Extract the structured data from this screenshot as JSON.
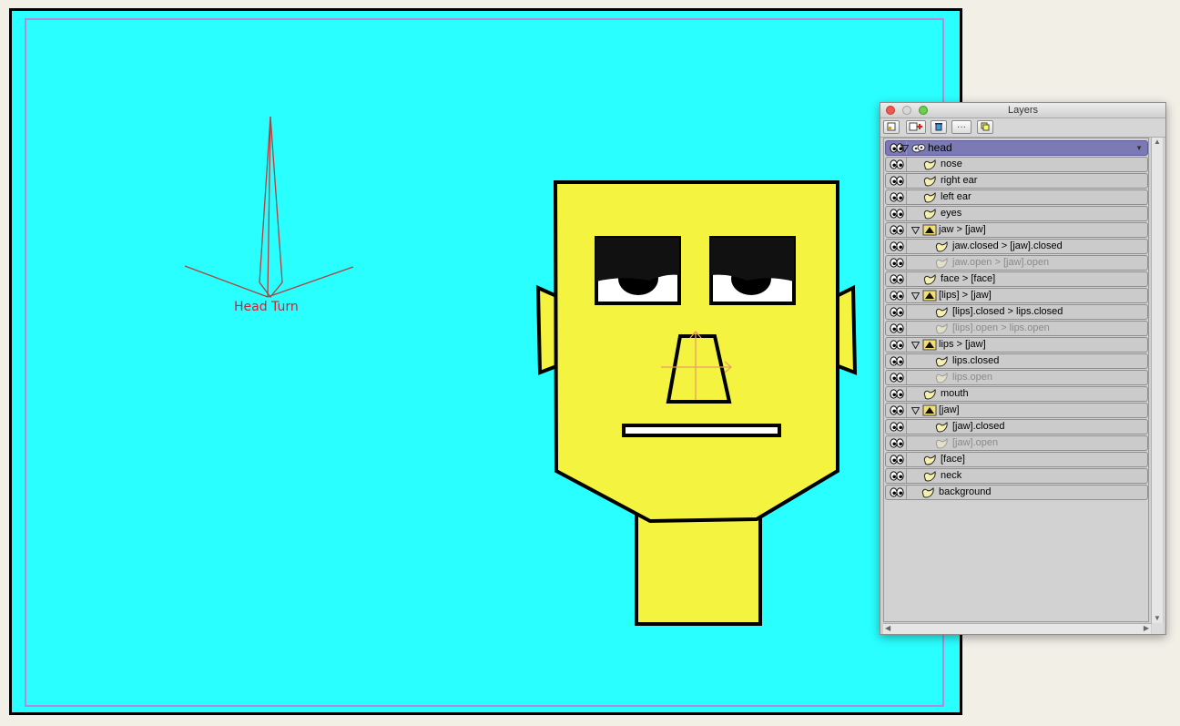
{
  "canvas": {
    "background_color": "#29ffff",
    "safe_frame_color": "#b48bd9",
    "bone_label": "Head Turn",
    "bone_color": "#a33",
    "face_color": "#f3f340"
  },
  "layers_panel": {
    "title": "Layers",
    "toolbar_icons": [
      "new-layer-icon",
      "new-group-icon",
      "delete-layer-icon",
      "more-options-icon",
      "duplicate-layer-icon"
    ],
    "more_label": "···",
    "layers": [
      {
        "label": "head",
        "kind": "group",
        "expanded": true,
        "selected": true,
        "visible": true,
        "depth": 0
      },
      {
        "label": "nose",
        "kind": "vector",
        "visible": true,
        "depth": 1
      },
      {
        "label": "right ear",
        "kind": "vector",
        "visible": true,
        "depth": 1
      },
      {
        "label": "left ear",
        "kind": "vector",
        "visible": true,
        "depth": 1
      },
      {
        "label": "eyes",
        "kind": "vector",
        "visible": true,
        "depth": 1
      },
      {
        "label": "jaw > [jaw]",
        "kind": "switch",
        "expanded": true,
        "visible": true,
        "depth": 1
      },
      {
        "label": "jaw.closed > [jaw].closed",
        "kind": "vector",
        "visible": true,
        "depth": 2
      },
      {
        "label": "jaw.open > [jaw].open",
        "kind": "vector",
        "visible": false,
        "depth": 2
      },
      {
        "label": "face > [face]",
        "kind": "vector",
        "visible": true,
        "depth": 1
      },
      {
        "label": "[lips] > [jaw]",
        "kind": "switch",
        "expanded": true,
        "visible": true,
        "depth": 1
      },
      {
        "label": "[lips].closed > lips.closed",
        "kind": "vector",
        "visible": true,
        "depth": 2
      },
      {
        "label": "[lips].open > lips.open",
        "kind": "vector",
        "visible": false,
        "depth": 2
      },
      {
        "label": "lips > [jaw]",
        "kind": "switch",
        "expanded": true,
        "visible": true,
        "depth": 1
      },
      {
        "label": "lips.closed",
        "kind": "vector",
        "visible": true,
        "depth": 2
      },
      {
        "label": "lips.open",
        "kind": "vector",
        "visible": false,
        "depth": 2
      },
      {
        "label": "mouth",
        "kind": "vector",
        "visible": true,
        "depth": 1
      },
      {
        "label": "[jaw]",
        "kind": "switch",
        "expanded": true,
        "visible": true,
        "depth": 1
      },
      {
        "label": "[jaw].closed",
        "kind": "vector",
        "visible": true,
        "depth": 2
      },
      {
        "label": "[jaw].open",
        "kind": "vector",
        "visible": false,
        "depth": 2
      },
      {
        "label": "[face]",
        "kind": "vector",
        "visible": true,
        "depth": 1
      },
      {
        "label": "neck",
        "kind": "vector",
        "visible": true,
        "depth": 1
      },
      {
        "label": "background",
        "kind": "vector",
        "visible": true,
        "depth": 0
      }
    ]
  }
}
